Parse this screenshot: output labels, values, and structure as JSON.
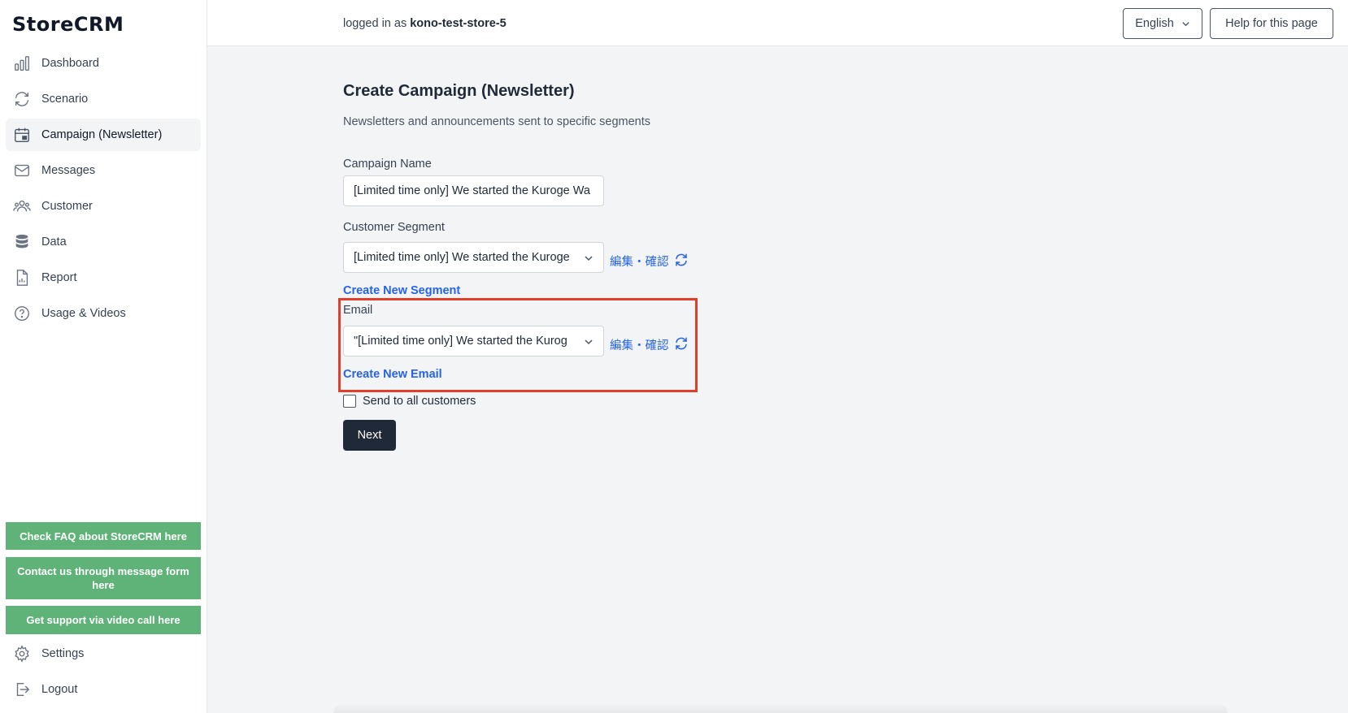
{
  "app": {
    "logo": "StoreCRM"
  },
  "sidebar": {
    "items": [
      {
        "label": "Dashboard",
        "icon": "bar-chart-icon"
      },
      {
        "label": "Scenario",
        "icon": "cycle-arrows-icon"
      },
      {
        "label": "Campaign (Newsletter)",
        "icon": "calendar-icon",
        "active": true
      },
      {
        "label": "Messages",
        "icon": "envelope-icon"
      },
      {
        "label": "Customer",
        "icon": "users-icon"
      },
      {
        "label": "Data",
        "icon": "database-icon"
      },
      {
        "label": "Report",
        "icon": "document-chart-icon"
      },
      {
        "label": "Usage & Videos",
        "icon": "question-circle-icon"
      }
    ],
    "help_buttons": {
      "faq": "Check FAQ about StoreCRM here",
      "contact": "Contact us through message form here",
      "video": "Get support via video call here"
    },
    "settings": "Settings",
    "logout": "Logout"
  },
  "header": {
    "logged_in_prefix": "logged in as",
    "username": "kono-test-store-5",
    "language": "English",
    "help_button": "Help for this page"
  },
  "main": {
    "title": "Create Campaign (Newsletter)",
    "description": "Newsletters and announcements sent to specific segments",
    "campaign_name": {
      "label": "Campaign Name",
      "value": "[Limited time only] We started the Kuroge Wa"
    },
    "customer_segment": {
      "label": "Customer Segment",
      "selected": "[Limited time only] We started the Kuroge",
      "edit_link": "編集・確認",
      "create_link": "Create New Segment"
    },
    "email": {
      "label": "Email",
      "selected": "\"[Limited time only] We started the Kurog",
      "edit_link": "編集・確認",
      "create_link": "Create New Email"
    },
    "send_all": "Send to all customers",
    "next_button": "Next"
  },
  "colors": {
    "accent_link": "#2563eb",
    "help_green": "#5fb378",
    "highlight_red": "#e0402b",
    "primary_dark": "#1f2937"
  }
}
